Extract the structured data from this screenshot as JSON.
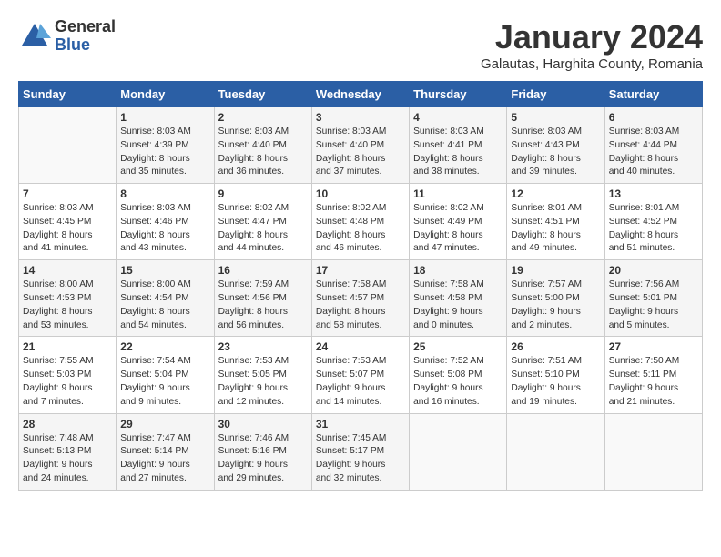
{
  "logo": {
    "general": "General",
    "blue": "Blue"
  },
  "title": "January 2024",
  "location": "Galautas, Harghita County, Romania",
  "days_of_week": [
    "Sunday",
    "Monday",
    "Tuesday",
    "Wednesday",
    "Thursday",
    "Friday",
    "Saturday"
  ],
  "weeks": [
    [
      {
        "day": "",
        "info": ""
      },
      {
        "day": "1",
        "info": "Sunrise: 8:03 AM\nSunset: 4:39 PM\nDaylight: 8 hours\nand 35 minutes."
      },
      {
        "day": "2",
        "info": "Sunrise: 8:03 AM\nSunset: 4:40 PM\nDaylight: 8 hours\nand 36 minutes."
      },
      {
        "day": "3",
        "info": "Sunrise: 8:03 AM\nSunset: 4:40 PM\nDaylight: 8 hours\nand 37 minutes."
      },
      {
        "day": "4",
        "info": "Sunrise: 8:03 AM\nSunset: 4:41 PM\nDaylight: 8 hours\nand 38 minutes."
      },
      {
        "day": "5",
        "info": "Sunrise: 8:03 AM\nSunset: 4:43 PM\nDaylight: 8 hours\nand 39 minutes."
      },
      {
        "day": "6",
        "info": "Sunrise: 8:03 AM\nSunset: 4:44 PM\nDaylight: 8 hours\nand 40 minutes."
      }
    ],
    [
      {
        "day": "7",
        "info": "Sunrise: 8:03 AM\nSunset: 4:45 PM\nDaylight: 8 hours\nand 41 minutes."
      },
      {
        "day": "8",
        "info": "Sunrise: 8:03 AM\nSunset: 4:46 PM\nDaylight: 8 hours\nand 43 minutes."
      },
      {
        "day": "9",
        "info": "Sunrise: 8:02 AM\nSunset: 4:47 PM\nDaylight: 8 hours\nand 44 minutes."
      },
      {
        "day": "10",
        "info": "Sunrise: 8:02 AM\nSunset: 4:48 PM\nDaylight: 8 hours\nand 46 minutes."
      },
      {
        "day": "11",
        "info": "Sunrise: 8:02 AM\nSunset: 4:49 PM\nDaylight: 8 hours\nand 47 minutes."
      },
      {
        "day": "12",
        "info": "Sunrise: 8:01 AM\nSunset: 4:51 PM\nDaylight: 8 hours\nand 49 minutes."
      },
      {
        "day": "13",
        "info": "Sunrise: 8:01 AM\nSunset: 4:52 PM\nDaylight: 8 hours\nand 51 minutes."
      }
    ],
    [
      {
        "day": "14",
        "info": "Sunrise: 8:00 AM\nSunset: 4:53 PM\nDaylight: 8 hours\nand 53 minutes."
      },
      {
        "day": "15",
        "info": "Sunrise: 8:00 AM\nSunset: 4:54 PM\nDaylight: 8 hours\nand 54 minutes."
      },
      {
        "day": "16",
        "info": "Sunrise: 7:59 AM\nSunset: 4:56 PM\nDaylight: 8 hours\nand 56 minutes."
      },
      {
        "day": "17",
        "info": "Sunrise: 7:58 AM\nSunset: 4:57 PM\nDaylight: 8 hours\nand 58 minutes."
      },
      {
        "day": "18",
        "info": "Sunrise: 7:58 AM\nSunset: 4:58 PM\nDaylight: 9 hours\nand 0 minutes."
      },
      {
        "day": "19",
        "info": "Sunrise: 7:57 AM\nSunset: 5:00 PM\nDaylight: 9 hours\nand 2 minutes."
      },
      {
        "day": "20",
        "info": "Sunrise: 7:56 AM\nSunset: 5:01 PM\nDaylight: 9 hours\nand 5 minutes."
      }
    ],
    [
      {
        "day": "21",
        "info": "Sunrise: 7:55 AM\nSunset: 5:03 PM\nDaylight: 9 hours\nand 7 minutes."
      },
      {
        "day": "22",
        "info": "Sunrise: 7:54 AM\nSunset: 5:04 PM\nDaylight: 9 hours\nand 9 minutes."
      },
      {
        "day": "23",
        "info": "Sunrise: 7:53 AM\nSunset: 5:05 PM\nDaylight: 9 hours\nand 12 minutes."
      },
      {
        "day": "24",
        "info": "Sunrise: 7:53 AM\nSunset: 5:07 PM\nDaylight: 9 hours\nand 14 minutes."
      },
      {
        "day": "25",
        "info": "Sunrise: 7:52 AM\nSunset: 5:08 PM\nDaylight: 9 hours\nand 16 minutes."
      },
      {
        "day": "26",
        "info": "Sunrise: 7:51 AM\nSunset: 5:10 PM\nDaylight: 9 hours\nand 19 minutes."
      },
      {
        "day": "27",
        "info": "Sunrise: 7:50 AM\nSunset: 5:11 PM\nDaylight: 9 hours\nand 21 minutes."
      }
    ],
    [
      {
        "day": "28",
        "info": "Sunrise: 7:48 AM\nSunset: 5:13 PM\nDaylight: 9 hours\nand 24 minutes."
      },
      {
        "day": "29",
        "info": "Sunrise: 7:47 AM\nSunset: 5:14 PM\nDaylight: 9 hours\nand 27 minutes."
      },
      {
        "day": "30",
        "info": "Sunrise: 7:46 AM\nSunset: 5:16 PM\nDaylight: 9 hours\nand 29 minutes."
      },
      {
        "day": "31",
        "info": "Sunrise: 7:45 AM\nSunset: 5:17 PM\nDaylight: 9 hours\nand 32 minutes."
      },
      {
        "day": "",
        "info": ""
      },
      {
        "day": "",
        "info": ""
      },
      {
        "day": "",
        "info": ""
      }
    ]
  ]
}
